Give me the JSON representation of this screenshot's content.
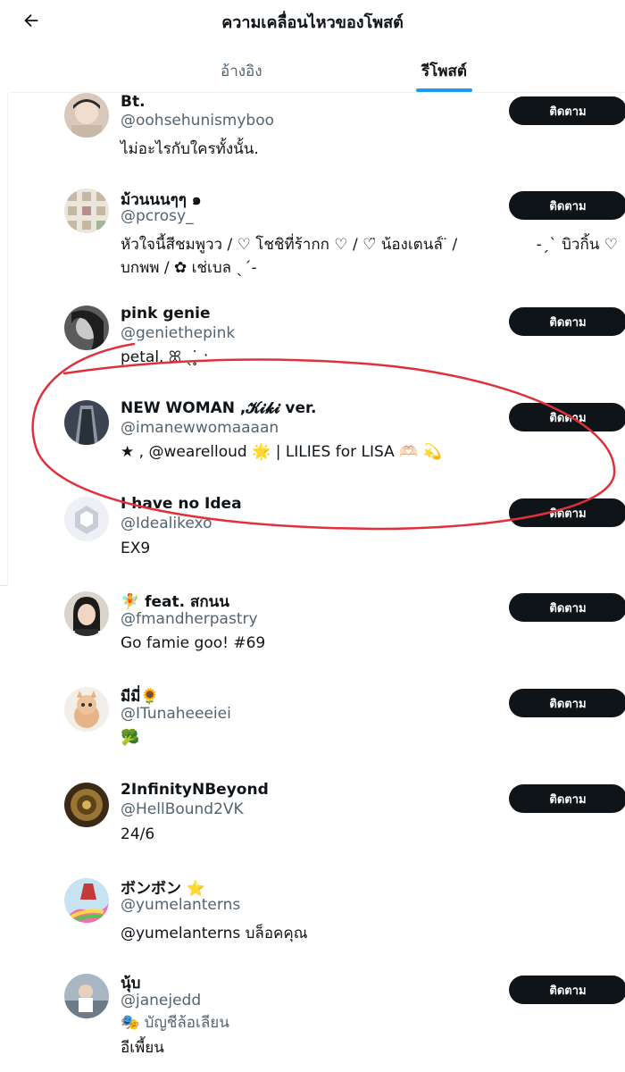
{
  "header": {
    "title": "ความเคลื่อนไหวของโพสต์",
    "tabs": [
      {
        "label": "อ้างอิง",
        "active": false
      },
      {
        "label": "รีโพสต์",
        "active": true
      }
    ]
  },
  "follow_label": "ติดตาม",
  "users": [
    {
      "name": "Bt.",
      "handle": "@oohsehunismyboo",
      "bio": "ไม่อะไรกับใครทั้งนั้น."
    },
    {
      "name": "ม้วนนนๆๆ ๑",
      "handle": "@pcrosy_",
      "bio": "หัวใจนี้สีชมพูวว / ♡ โชชิที่ร้ากก ♡ / ♡̈ น้องเตนล์ ̈ /",
      "bio_right": "-ˏˋ บิวกิ้น ♡",
      "bio_line2": "บกพพ / ✿ เช่เบล ˎ´-"
    },
    {
      "name": "pink genie",
      "handle": "@geniethepink",
      "bio": "petal. ꕤ ˎ ̥̇ :"
    },
    {
      "name": "NEW WOMAN ,𝓚𝓲𝓴𝓲 ver.",
      "handle": "@imanewwomaaaan",
      "bio": "★ , @wearelloud 🌟 | LILIES for LISA 🫶🏻 💫"
    },
    {
      "name": "I have no Idea",
      "handle": "@Idealikexo",
      "bio": "EX9"
    },
    {
      "name": "feat. สกนน",
      "handle": "@fmandherpastry",
      "bio": "Go famie goo! #69"
    },
    {
      "name": "มีมี่🌻",
      "handle": "@ITunaheeeiei",
      "bio": "🥦"
    },
    {
      "name": "2InfinityNBeyond",
      "handle": "@HellBound2VK",
      "bio": "24/6"
    },
    {
      "name": "ボンボン ⭐",
      "handle": "@yumelanterns",
      "bio": "@yumelanterns บล็อคคุณ"
    },
    {
      "name": "นุ้บ",
      "handle": "@janejedd",
      "badge": "🎭 บัญชีล้อเลียน",
      "bio": "อีเพี้ยน"
    }
  ],
  "colors": {
    "accent": "#1d9bf0",
    "annotation": "#e0303a",
    "button_bg": "#0f1419"
  }
}
